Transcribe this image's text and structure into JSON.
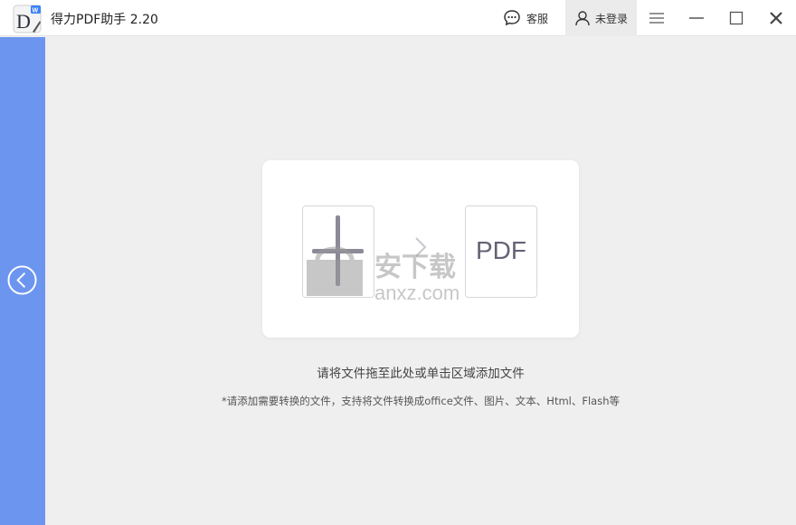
{
  "app": {
    "title": "得力PDF助手 2.20",
    "logo_letter": "D",
    "logo_badge": "W"
  },
  "header": {
    "service_label": "客服",
    "login_label": "未登录"
  },
  "icons": {
    "logo": "app-logo-icon",
    "service": "chat-bubble-icon",
    "user": "user-icon",
    "menu": "hamburger-menu-icon",
    "minimize": "minimize-icon",
    "maximize": "maximize-icon",
    "close": "close-icon",
    "back": "chevron-left-circle-icon"
  },
  "dropzone": {
    "target_label": "PDF",
    "instruction": "请将文件拖至此处或单击区域添加文件",
    "supported_note": "*请添加需要转换的文件，支持将文件转换成office文件、图片、文本、Html、Flash等"
  },
  "watermark": {
    "text": "安下载",
    "domain": "anxz.com"
  },
  "colors": {
    "sidebar": "#6c95ef",
    "background": "#efefef",
    "card": "#ffffff",
    "pdf_text": "#666274"
  }
}
